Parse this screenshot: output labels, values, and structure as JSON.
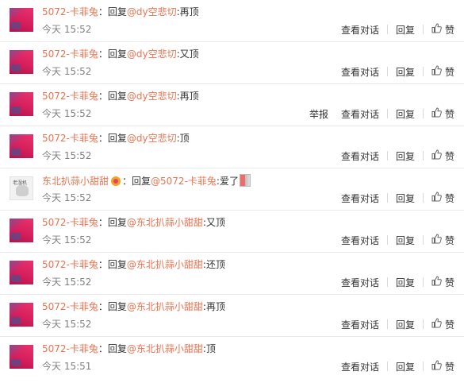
{
  "labels": {
    "reply_prefix": "：回复",
    "view_conversation": "查看对话",
    "reply": "回复",
    "like": "赞",
    "report": "举报"
  },
  "comments": [
    {
      "user": "5072-卡菲兔",
      "mention": "@dy空悲切",
      "text": ":再顶",
      "time": "今天 15:52",
      "avatar": "pink"
    },
    {
      "user": "5072-卡菲兔",
      "mention": "@dy空悲切",
      "text": ":又顶",
      "time": "今天 15:52",
      "avatar": "pink"
    },
    {
      "user": "5072-卡菲兔",
      "mention": "@dy空悲切",
      "text": ":再顶",
      "time": "今天 15:52",
      "avatar": "pink",
      "report": true
    },
    {
      "user": "5072-卡菲兔",
      "mention": "@dy空悲切",
      "text": ":顶",
      "time": "今天 15:52",
      "avatar": "pink"
    },
    {
      "user": "东北扒蒜小甜甜",
      "mention": "@5072-卡菲兔",
      "text": ":爱了",
      "time": "今天 15:52",
      "avatar": "grey",
      "avatar_text": "老湿机",
      "badge": true
    },
    {
      "user": "5072-卡菲兔",
      "mention": "@东北扒蒜小甜甜",
      "text": ":又顶",
      "time": "今天 15:52",
      "avatar": "pink"
    },
    {
      "user": "5072-卡菲兔",
      "mention": "@东北扒蒜小甜甜",
      "text": ":还顶",
      "time": "今天 15:52",
      "avatar": "pink"
    },
    {
      "user": "5072-卡菲兔",
      "mention": "@东北扒蒜小甜甜",
      "text": ":再顶",
      "time": "今天 15:52",
      "avatar": "pink"
    },
    {
      "user": "5072-卡菲兔",
      "mention": "@东北扒蒜小甜甜",
      "text": ":顶",
      "time": "今天 15:51",
      "avatar": "pink"
    }
  ],
  "colors": {
    "link": "#eb7350",
    "text": "#333333",
    "muted": "#808080",
    "divider": "#eaeaea"
  },
  "icons": {
    "like": "thumbs-up-icon"
  }
}
